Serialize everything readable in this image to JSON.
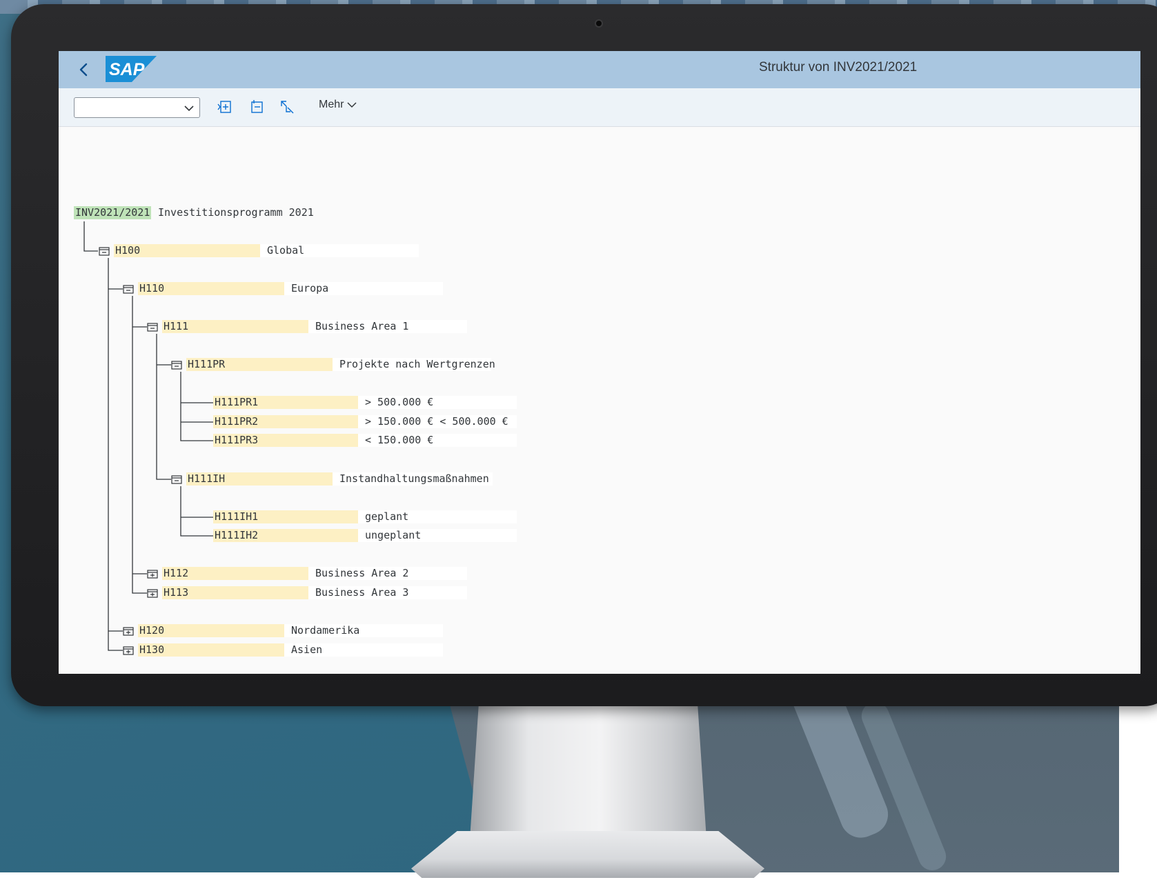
{
  "app": {
    "title": "Struktur von INV2021/2021",
    "logo_text": "SAP"
  },
  "toolbar": {
    "select_value": "",
    "more_label": "Mehr",
    "icons": [
      "expand-subtree-icon",
      "collapse-subtree-icon",
      "select-pointer-icon"
    ]
  },
  "tree": {
    "root": {
      "id": "INV2021/2021",
      "desc": "Investitionsprogramm 2021"
    },
    "nodes": [
      {
        "id": "H100",
        "desc": "Global",
        "state": "expanded"
      },
      {
        "id": "H110",
        "desc": "Europa",
        "state": "expanded"
      },
      {
        "id": "H111",
        "desc": "Business Area 1",
        "state": "expanded"
      },
      {
        "id": "H111PR",
        "desc": "Projekte nach Wertgrenzen",
        "state": "expanded"
      },
      {
        "id": "H111PR1",
        "desc": "> 500.000 €",
        "state": "leaf"
      },
      {
        "id": "H111PR2",
        "desc": "> 150.000 € < 500.000 €",
        "state": "leaf"
      },
      {
        "id": "H111PR3",
        "desc": "< 150.000 €",
        "state": "leaf"
      },
      {
        "id": "H111IH",
        "desc": "Instandhaltungsmaßnahmen",
        "state": "expanded"
      },
      {
        "id": "H111IH1",
        "desc": "geplant",
        "state": "leaf"
      },
      {
        "id": "H111IH2",
        "desc": "ungeplant",
        "state": "leaf"
      },
      {
        "id": "H112",
        "desc": "Business Area 2",
        "state": "collapsed"
      },
      {
        "id": "H113",
        "desc": "Business Area 3",
        "state": "collapsed"
      },
      {
        "id": "H120",
        "desc": "Nordamerika",
        "state": "collapsed"
      },
      {
        "id": "H130",
        "desc": "Asien",
        "state": "collapsed"
      }
    ]
  },
  "colors": {
    "shellbar": "#a9c6e0",
    "toolbar": "#edf3f8",
    "root_highlight": "#bfe3b8",
    "node_highlight": "#fdf0c4",
    "sap_logo_blue": "#1a8fd6"
  }
}
